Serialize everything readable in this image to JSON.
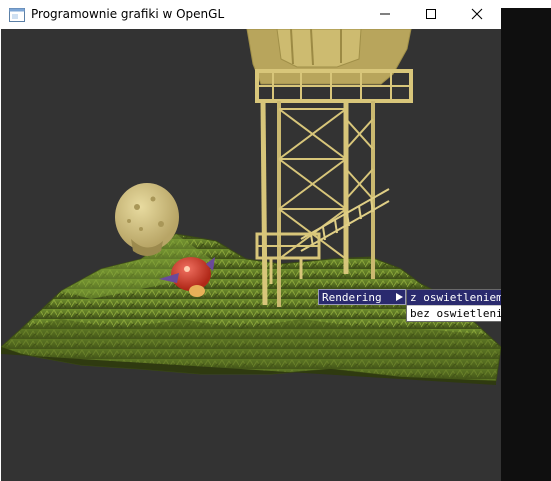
{
  "window": {
    "title": "Programownie grafiki w OpenGL",
    "icon": "window-app-icon",
    "buttons": {
      "minimize": "minimize-icon",
      "maximize": "maximize-icon",
      "close": "close-icon"
    }
  },
  "context_menu": {
    "label": "Rendering",
    "items": [
      {
        "label": "z oswietleniem",
        "selected": true
      },
      {
        "label": "bez oswietlenia",
        "selected": false
      }
    ]
  },
  "colors": {
    "viewport_bg": "#333333",
    "menu_highlight": "#2a2a6e",
    "terrain": "#6b8a2c",
    "tower": "#d8c67a"
  }
}
